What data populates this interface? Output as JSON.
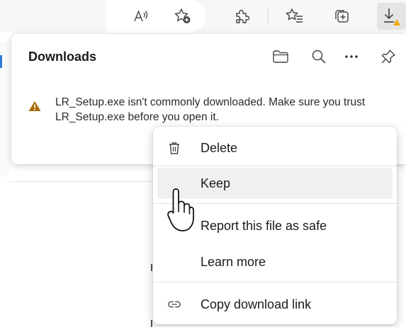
{
  "toolbar": {
    "read_aloud_icon": "read-aloud-icon",
    "add_favorite_icon": "star-add-icon",
    "extensions_icon": "puzzle-icon",
    "favorites_icon": "favorites-icon",
    "collections_icon": "collections-icon",
    "downloads_icon": "download-icon"
  },
  "downloads_panel": {
    "title": "Downloads",
    "warning_message": "LR_Setup.exe isn't commonly downloaded. Make sure you trust LR_Setup.exe before you open it.",
    "icons": [
      "folder-icon",
      "search-icon",
      "more-icon",
      "pin-icon"
    ]
  },
  "context_menu": {
    "items": [
      {
        "label": "Delete",
        "icon": "trash-icon"
      },
      {
        "label": "Keep",
        "icon": ""
      },
      {
        "label": "Report this file as safe",
        "icon": ""
      },
      {
        "label": "Learn more",
        "icon": ""
      },
      {
        "label": "Copy download link",
        "icon": "link-icon"
      }
    ],
    "hovered_index": 1
  },
  "colors": {
    "warning": "#a86b00",
    "accent_badge": "#f2a900",
    "menu_hover": "#f0f0f0"
  }
}
